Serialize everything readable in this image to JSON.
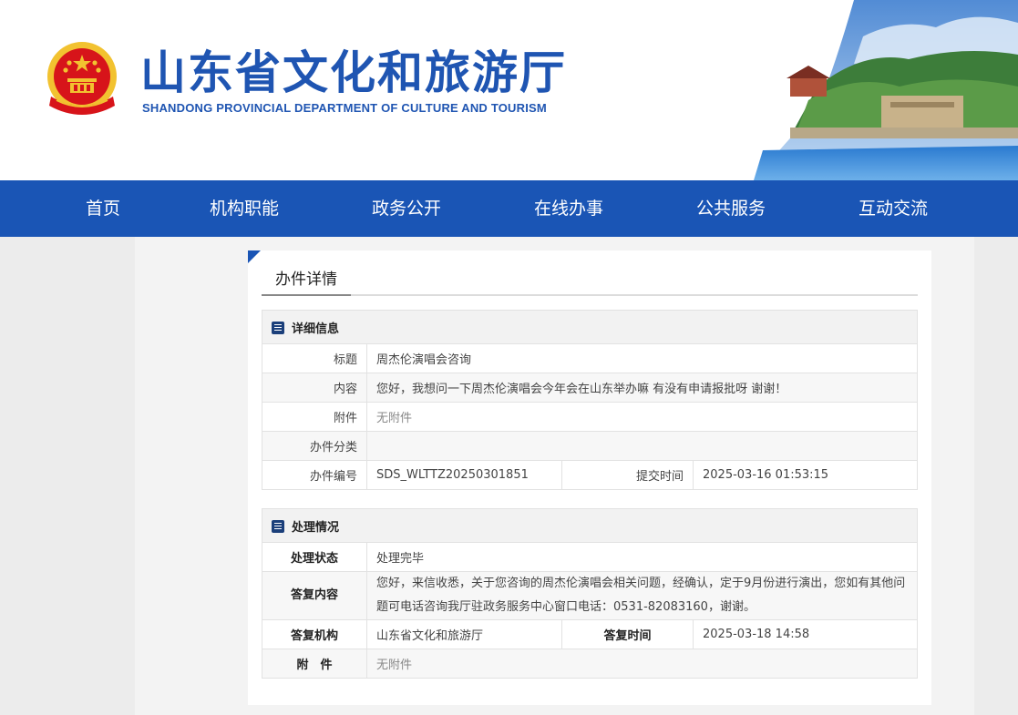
{
  "header": {
    "title": "山东省文化和旅游厅",
    "subtitle": "SHANDONG PROVINCIAL DEPARTMENT OF CULTURE AND  TOURISM",
    "emblem_icon": "national-emblem-icon"
  },
  "nav": {
    "items": [
      "首页",
      "机构职能",
      "政务公开",
      "在线办事",
      "公共服务",
      "互动交流"
    ]
  },
  "panel": {
    "tab_label": "办件详情"
  },
  "details": {
    "section_title": "详细信息",
    "title_label": "标题",
    "title_value": "周杰伦演唱会咨询",
    "content_label": "内容",
    "content_value": "您好，我想问一下周杰伦演唱会今年会在山东举办嘛 有没有申请报批呀 谢谢！",
    "attachment_label": "附件",
    "attachment_value": "无附件",
    "category_label": "办件分类",
    "category_value": "",
    "number_label": "办件编号",
    "number_value": "SDS_WLTTZ20250301851",
    "submit_time_label": "提交时间",
    "submit_time_value": "2025-03-16 01:53:15"
  },
  "processing": {
    "section_title": "处理情况",
    "status_label": "处理状态",
    "status_value": "处理完毕",
    "reply_label": "答复内容",
    "reply_value": "您好，来信收悉，关于您咨询的周杰伦演唱会相关问题，经确认，定于9月份进行演出，您如有其他问题可电话咨询我厅驻政务服务中心窗口电话：0531-82083160，谢谢。",
    "org_label": "答复机构",
    "org_value": "山东省文化和旅游厅",
    "reply_time_label": "答复时间",
    "reply_time_value": "2025-03-18 14:58",
    "attachment_label": "附　件",
    "attachment_value": "无附件"
  },
  "colors": {
    "brand_blue": "#1a55b5",
    "title_blue": "#1f55b2",
    "emblem_red": "#d7141a",
    "emblem_gold": "#f2c230"
  }
}
